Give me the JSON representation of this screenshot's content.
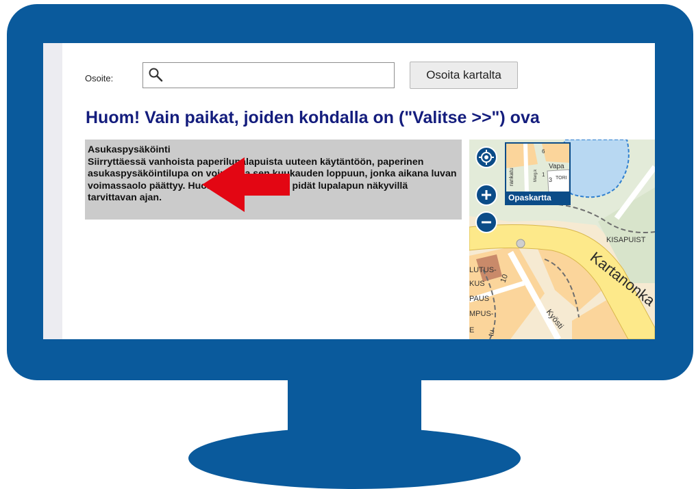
{
  "address": {
    "label": "Osoite:",
    "value": "",
    "placeholder": "",
    "point_on_map_label": "Osoita kartalta"
  },
  "notice": {
    "heading": "Huom! Vain paikat, joiden kohdalla on (\"Valitse >>\") ova"
  },
  "info": {
    "title": "Asukaspysäköinti",
    "body": "Siirryttäessä vanhoista paperilupalapuista uuteen käytäntöön, paperinen asukaspysäköintilupa on voimassa sen kuukauden loppuun, jonka aikana luvan voimassaolo päättyy. Huomioithan tämän ja pidät lupalapun näkyvillä tarvittavan ajan."
  },
  "map": {
    "layer_label": "Opaskartta",
    "labels": {
      "kisapuisto": "KISAPUIST",
      "kartanonkatu": "Kartanonka",
      "kyosti": "Kyösti",
      "number_10": "10",
      "lutus": "LUTUS-",
      "kus": "KUS",
      "paus": "PAUS",
      "mpus": "MPUS-",
      "e": "E",
      "tu": "tu"
    },
    "thumbnail_labels": {
      "vapa": "Vapa",
      "tori": "TORI",
      "n3": "3",
      "n6": "6",
      "n1": "1",
      "street": "rankatu",
      "small": "Marg.k"
    },
    "icons": {
      "locate": "crosshair-icon",
      "zoom_in": "plus-icon",
      "zoom_out": "minus-icon"
    }
  },
  "colors": {
    "monitor": "#0a5a9c",
    "heading": "#141d7d",
    "info_bg": "#cbcbcb",
    "map_button": "#0b4c88",
    "arrow": "#e30613",
    "road_yellow": "#fde98a",
    "block_orange": "#fbd59b",
    "park_green": "#e3ebd9",
    "water_blue": "#b8d8f2"
  }
}
